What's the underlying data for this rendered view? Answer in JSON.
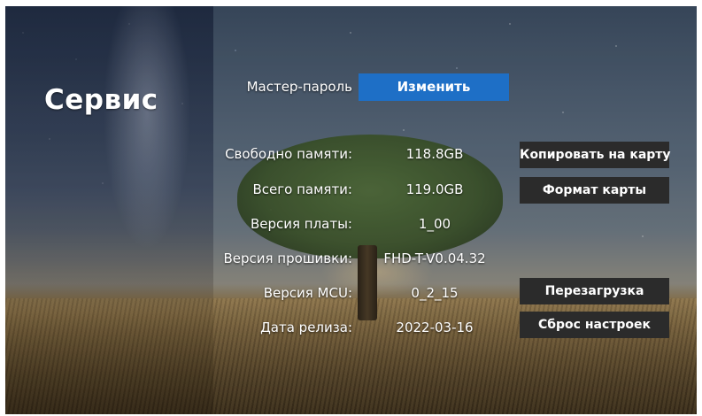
{
  "screen": {
    "title": "Сервис"
  },
  "master_password": {
    "label": "Мастер-пароль",
    "button_label": "Изменить"
  },
  "info_rows": [
    {
      "label": "Свободно памяти:",
      "value": "118.8GB"
    },
    {
      "label": "Всего памяти:",
      "value": "119.0GB"
    },
    {
      "label": "Версия платы:",
      "value": "1_00"
    },
    {
      "label": "Версия прошивки:",
      "value": "FHD-T-V0.04.32"
    },
    {
      "label": "Версия MCU:",
      "value": "0_2_15"
    },
    {
      "label": "Дата релиза:",
      "value": "2022-03-16"
    }
  ],
  "actions": {
    "copy_to_card": "Копировать на карту",
    "format_card": "Формат карты",
    "reboot": "Перезагрузка",
    "reset_settings": "Сброс настроек"
  },
  "colors": {
    "accent_blue": "#1e6fc6",
    "button_dark": "#2b2b2b",
    "text": "#ffffff"
  }
}
